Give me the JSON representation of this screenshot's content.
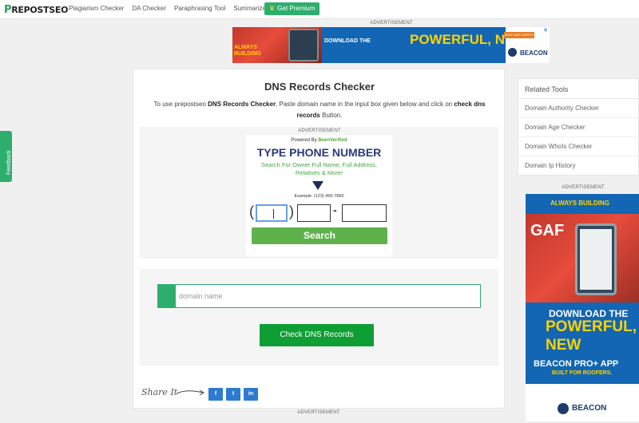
{
  "header": {
    "logo_prefix": "P",
    "logo_rest": "REPOSTSEO",
    "nav": [
      "Plagiarism Checker",
      "DA Checker",
      "Paraphrasing Tool",
      "Summarizer"
    ],
    "premium_label": "Get Premium"
  },
  "ads": {
    "label": "ADVERTISEMENT",
    "top_banner": {
      "always_line1": "ALWAYS",
      "always_line2": "BUILDING",
      "download": "DOWNLOAD THE",
      "powerful": "POWERFUL, NE",
      "shop": "SHOP ABC SUPPLY",
      "brand": "BEACON"
    },
    "phone_ad": {
      "powered_prefix": "Powered By",
      "powered_brand": "BeenVerified",
      "headline": "TYPE PHONE NUMBER",
      "sub": "Search For Owner Full Name, Full Address, Relatives & More!",
      "example": "Example: (123) 456-7890",
      "search_label": "Search"
    },
    "side_ad": {
      "band": "ALWAYS BUILDING",
      "line1": "DOWNLOAD THE",
      "line2": "POWERFUL,",
      "line3": "NEW",
      "line4": "BEACON PRO+ APP",
      "line5": "BUILT FOR ROOFERS.",
      "brand": "BEACON"
    }
  },
  "feedback_label": "Feedback",
  "tool": {
    "title": "DNS Records Checker",
    "desc_1": "To use prepostseo ",
    "desc_bold1": "DNS Records Checker",
    "desc_2": ", Paste domain name in the input box given below and click on ",
    "desc_bold2": "check dns records",
    "desc_3": " Button.",
    "input_placeholder": "domain name",
    "button_label": "Check DNS Records"
  },
  "share": {
    "label": "Share It",
    "icons": [
      "f",
      "t",
      "in"
    ]
  },
  "related": {
    "title": "Related Tools",
    "items": [
      "Domain Authority Checker",
      "Domain Age Checker",
      "Domain WhoIs Checker",
      "Domain Ip History"
    ]
  }
}
